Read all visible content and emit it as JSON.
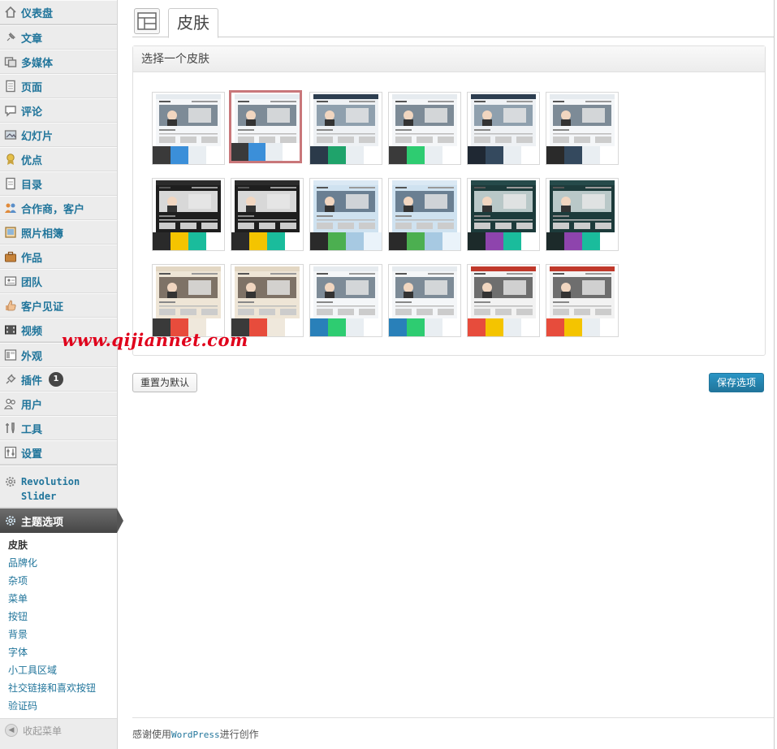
{
  "sidebar": {
    "groups": [
      [
        {
          "label": "仪表盘",
          "icon": "dashboard-icon"
        }
      ],
      [
        {
          "label": "文章",
          "icon": "pin-icon"
        },
        {
          "label": "多媒体",
          "icon": "media-icon"
        },
        {
          "label": "页面",
          "icon": "page-icon"
        },
        {
          "label": "评论",
          "icon": "comment-icon"
        },
        {
          "label": "幻灯片",
          "icon": "slides-icon"
        },
        {
          "label": "优点",
          "icon": "award-icon"
        },
        {
          "label": "目录",
          "icon": "list-icon"
        },
        {
          "label": "合作商，客户",
          "icon": "partners-icon"
        },
        {
          "label": "照片相簿",
          "icon": "album-icon"
        },
        {
          "label": "作品",
          "icon": "briefcase-icon"
        },
        {
          "label": "团队",
          "icon": "team-icon"
        },
        {
          "label": "客户见证",
          "icon": "thumbs-up-icon"
        },
        {
          "label": "视频",
          "icon": "video-icon"
        }
      ],
      [
        {
          "label": "外观",
          "icon": "appearance-icon"
        },
        {
          "label": "插件",
          "icon": "plugin-icon",
          "badge": "1"
        },
        {
          "label": "用户",
          "icon": "users-icon"
        },
        {
          "label": "工具",
          "icon": "tools-icon"
        },
        {
          "label": "设置",
          "icon": "settings-icon"
        }
      ]
    ],
    "revolution": {
      "line1": "Revolution",
      "line2": "Slider",
      "icon": "gear-icon"
    },
    "theme_options": {
      "label": "主题选项",
      "icon": "gear-icon"
    },
    "submenu": [
      "皮肤",
      "品牌化",
      "杂项",
      "菜单",
      "按钮",
      "背景",
      "字体",
      "小工具区域",
      "社交链接和喜欢按钮",
      "验证码"
    ],
    "submenu_current": 0,
    "collapse_label": "收起菜单"
  },
  "header": {
    "tab_label": "皮肤"
  },
  "panel": {
    "title": "选择一个皮肤",
    "selected_index": 1,
    "skins": [
      {
        "shot": "light",
        "colors": [
          "#3a3a3a",
          "#3b8fd9",
          "#e9eef2",
          "#ffffff"
        ]
      },
      {
        "shot": "light",
        "colors": [
          "#3a3a3a",
          "#3b8fd9",
          "#e9eef2",
          "#ffffff"
        ]
      },
      {
        "shot": "navy",
        "colors": [
          "#2b3a4a",
          "#1fa36b",
          "#e9eef2",
          "#ffffff"
        ]
      },
      {
        "shot": "light",
        "colors": [
          "#3a3a3a",
          "#2ecc71",
          "#e9eef2",
          "#ffffff"
        ]
      },
      {
        "shot": "navy",
        "colors": [
          "#1f2833",
          "#34495e",
          "#e9eef2",
          "#ffffff"
        ]
      },
      {
        "shot": "light",
        "colors": [
          "#2a2a2a",
          "#34495e",
          "#e9eef2",
          "#ffffff"
        ]
      },
      {
        "shot": "dark",
        "colors": [
          "#2a2a2a",
          "#f4c400",
          "#1abc9c",
          "#ffffff"
        ]
      },
      {
        "shot": "dark",
        "colors": [
          "#2a2a2a",
          "#f4c400",
          "#1abc9c",
          "#ffffff"
        ]
      },
      {
        "shot": "sky",
        "colors": [
          "#2a2a2a",
          "#4caf50",
          "#a7c9e2",
          "#eaf3fa"
        ]
      },
      {
        "shot": "sky",
        "colors": [
          "#2a2a2a",
          "#4caf50",
          "#a7c9e2",
          "#eaf3fa"
        ]
      },
      {
        "shot": "teal",
        "colors": [
          "#1c2a2a",
          "#8e44ad",
          "#1abc9c",
          "#ffffff"
        ]
      },
      {
        "shot": "teal",
        "colors": [
          "#1c2a2a",
          "#8e44ad",
          "#1abc9c",
          "#ffffff"
        ]
      },
      {
        "shot": "beige",
        "colors": [
          "#3a3a3a",
          "#e74c3c",
          "#efe8dc",
          "#ffffff"
        ]
      },
      {
        "shot": "beige",
        "colors": [
          "#3a3a3a",
          "#e74c3c",
          "#efe8dc",
          "#ffffff"
        ]
      },
      {
        "shot": "light",
        "colors": [
          "#2980b9",
          "#2ecc71",
          "#e9eef2",
          "#ffffff"
        ]
      },
      {
        "shot": "light",
        "colors": [
          "#2980b9",
          "#2ecc71",
          "#e9eef2",
          "#ffffff"
        ]
      },
      {
        "shot": "red",
        "colors": [
          "#e74c3c",
          "#f4c400",
          "#e9eef2",
          "#ffffff"
        ]
      },
      {
        "shot": "red",
        "colors": [
          "#e74c3c",
          "#f4c400",
          "#e9eef2",
          "#ffffff"
        ]
      }
    ]
  },
  "watermark": "www.qijiannet.com",
  "buttons": {
    "reset": "重置为默认",
    "save": "保存选项"
  },
  "footer": {
    "prefix": "感谢使用",
    "brand": "WordPress",
    "suffix": "进行创作"
  }
}
